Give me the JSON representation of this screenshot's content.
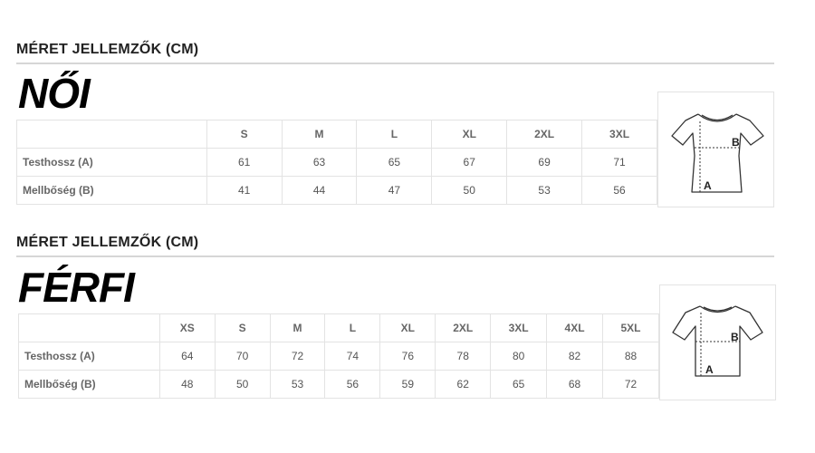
{
  "women": {
    "header": "MÉRET JELLEMZŐK (CM)",
    "title": "NŐI",
    "sizes": [
      "S",
      "M",
      "L",
      "XL",
      "2XL",
      "3XL"
    ],
    "rows": [
      {
        "label": "Testhossz (A)",
        "values": [
          "61",
          "63",
          "65",
          "67",
          "69",
          "71"
        ]
      },
      {
        "label": "Mellbőség (B)",
        "values": [
          "41",
          "44",
          "47",
          "50",
          "53",
          "56"
        ]
      }
    ],
    "diagram": {
      "label_a": "A",
      "label_b": "B",
      "icon": "womens-tshirt-icon"
    }
  },
  "men": {
    "header": "MÉRET JELLEMZŐK (CM)",
    "title": "FÉRFI",
    "sizes": [
      "XS",
      "S",
      "M",
      "L",
      "XL",
      "2XL",
      "3XL",
      "4XL",
      "5XL"
    ],
    "rows": [
      {
        "label": "Testhossz (A)",
        "values": [
          "64",
          "70",
          "72",
          "74",
          "76",
          "78",
          "80",
          "82",
          "88"
        ]
      },
      {
        "label": "Mellbőség (B)",
        "values": [
          "48",
          "50",
          "53",
          "56",
          "59",
          "62",
          "65",
          "68",
          "72"
        ]
      }
    ],
    "diagram": {
      "label_a": "A",
      "label_b": "B",
      "icon": "mens-tshirt-icon"
    }
  }
}
